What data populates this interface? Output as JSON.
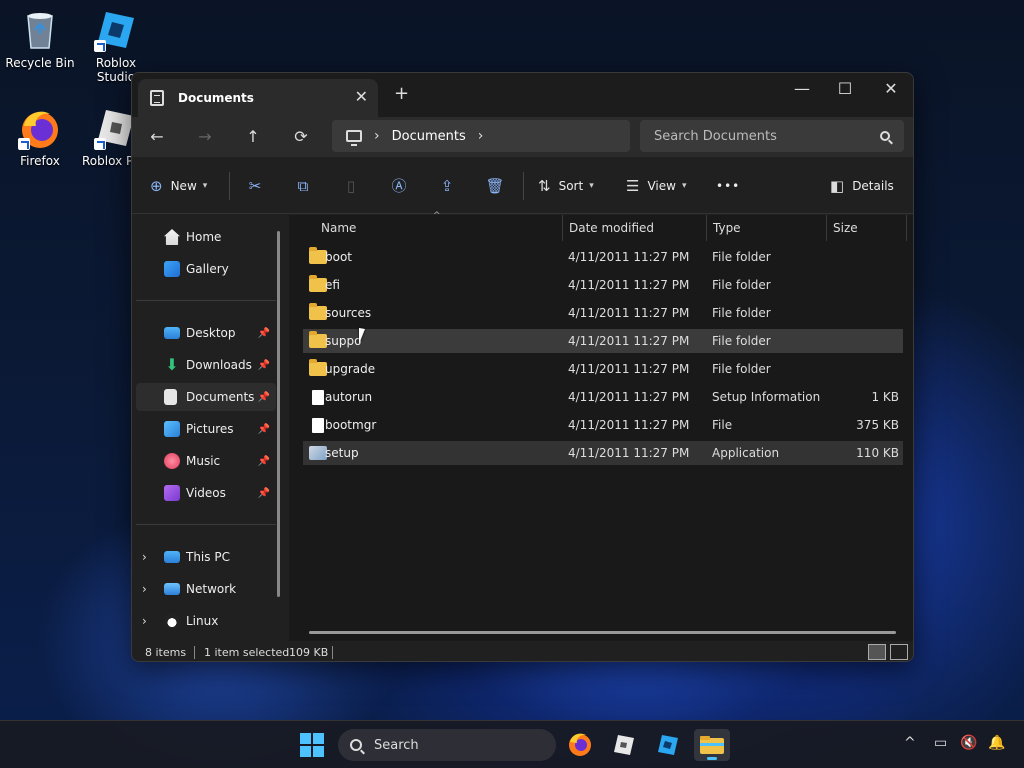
{
  "desktop": {
    "icons": [
      {
        "label": "Recycle Bin"
      },
      {
        "label": "Roblox Studio"
      },
      {
        "label": "Firefox"
      },
      {
        "label": "Roblox Pl"
      }
    ]
  },
  "window": {
    "tab_title": "Documents",
    "new_tab": "+",
    "controls": {
      "minimize": "—",
      "maximize": "☐",
      "close": "✕"
    }
  },
  "nav_buttons": {
    "back": "←",
    "forward": "→",
    "up": "↑",
    "refresh": "⟳"
  },
  "address": {
    "chevron": "›",
    "crumbs": [
      "Documents"
    ]
  },
  "search": {
    "placeholder": "Search Documents"
  },
  "toolbar": {
    "new_label": "New",
    "sort_label": "Sort",
    "view_label": "View",
    "more": "•••",
    "details_label": "Details"
  },
  "sidebar": {
    "top": [
      {
        "label": "Home"
      },
      {
        "label": "Gallery"
      }
    ],
    "quick": [
      {
        "label": "Desktop",
        "pinned": true
      },
      {
        "label": "Downloads",
        "pinned": true
      },
      {
        "label": "Documents",
        "pinned": true,
        "selected": true
      },
      {
        "label": "Pictures",
        "pinned": true
      },
      {
        "label": "Music",
        "pinned": true
      },
      {
        "label": "Videos",
        "pinned": true
      }
    ],
    "bottom": [
      {
        "label": "This PC"
      },
      {
        "label": "Network"
      },
      {
        "label": "Linux"
      }
    ]
  },
  "file_list": {
    "columns": [
      "Name",
      "Date modified",
      "Type",
      "Size"
    ],
    "rows": [
      {
        "name": "boot",
        "date": "4/11/2011 11:27 PM",
        "type": "File folder",
        "size": "",
        "icon": "folder-icon"
      },
      {
        "name": "efi",
        "date": "4/11/2011 11:27 PM",
        "type": "File folder",
        "size": "",
        "icon": "folder-icon"
      },
      {
        "name": "sources",
        "date": "4/11/2011 11:27 PM",
        "type": "File folder",
        "size": "",
        "icon": "folder-icon"
      },
      {
        "name": "suppo",
        "date": "4/11/2011 11:27 PM",
        "type": "File folder",
        "size": "",
        "icon": "folder-icon"
      },
      {
        "name": "upgrade",
        "date": "4/11/2011 11:27 PM",
        "type": "File folder",
        "size": "",
        "icon": "folder-icon"
      },
      {
        "name": "autorun",
        "date": "4/11/2011 11:27 PM",
        "type": "Setup Information",
        "size": "1 KB",
        "icon": "settings-file-icon"
      },
      {
        "name": "bootmgr",
        "date": "4/11/2011 11:27 PM",
        "type": "File",
        "size": "375 KB",
        "icon": "file-icon"
      },
      {
        "name": "setup",
        "date": "4/11/2011 11:27 PM",
        "type": "Application",
        "size": "110 KB",
        "icon": "setup-app-icon"
      }
    ]
  },
  "status": {
    "items": "8 items",
    "selection": "1 item selected",
    "size": "109 KB"
  },
  "taskbar": {
    "search_placeholder": "Search"
  }
}
